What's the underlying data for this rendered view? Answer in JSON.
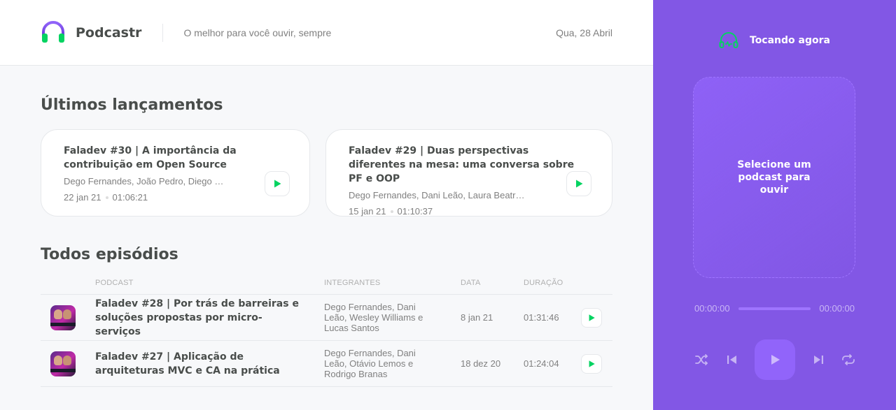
{
  "header": {
    "app_name": "Podcastr",
    "tagline": "O melhor para você ouvir, sempre",
    "date": "Qua, 28 Abril",
    "logo_icon": "headphones-icon"
  },
  "latest": {
    "title": "Últimos lançamentos",
    "episodes": [
      {
        "title": "Faladev #30 | A importância da contribuição em Open Source",
        "members": "Dego Fernandes, João Pedro, Diego Haz, Bruno Lemos, Guilherme Rodz e Luiz Batanero",
        "date": "22 jan 21",
        "duration": "01:06:21"
      },
      {
        "title": "Faladev #29 | Duas perspectivas diferentes na mesa: uma conversa sobre PF e OOP",
        "members": "Dego Fernandes, Dani Leão, Laura Beatris, Hugo Schiavolin e Joao Pedro",
        "date": "15 jan 21",
        "duration": "01:10:37"
      }
    ]
  },
  "all": {
    "title": "Todos episódios",
    "columns": [
      "Podcast",
      "Integrantes",
      "Data",
      "Duração"
    ],
    "episodes": [
      {
        "title": "Faladev #28 | Por trás de barreiras e soluções propostas por micro-serviços",
        "members": "Dego Fernandes, Dani Leão, Wesley Williams e Lucas Santos",
        "date": "8 jan 21",
        "duration": "01:31:46"
      },
      {
        "title": "Faladev #27 | Aplicação de arquiteturas MVC e CA na prática",
        "members": "Dego Fernandes, Dani Leão, Otávio Lemos e Rodrigo Branas",
        "date": "18 dez 20",
        "duration": "01:24:04"
      }
    ]
  },
  "player": {
    "heading": "Tocando agora",
    "empty_message": "Selecione um podcast para ouvir",
    "current_time": "00:00:00",
    "total_time": "00:00:00",
    "controls": [
      "shuffle-icon",
      "previous-icon",
      "play-icon",
      "next-icon",
      "repeat-icon"
    ]
  },
  "colors": {
    "accent_green": "#04d361",
    "player_purple": "#8257e5",
    "text_dark": "#494d4b",
    "text_muted": "#808080"
  }
}
